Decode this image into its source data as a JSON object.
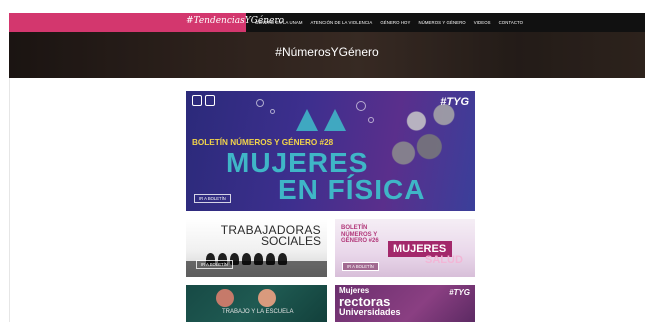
{
  "header": {
    "brand": "#TendenciasYGénero",
    "nav": [
      "GÉNERO EN LA UNAM",
      "ATENCIÓN DE LA VIOLENCIA",
      "GÉNERO HOY",
      "NÚMEROS Y GÉNERO",
      "VIDEOS",
      "CONTACTO"
    ],
    "brand_color": "#d3376e"
  },
  "hero": {
    "title": "#NúmerosYGénero"
  },
  "cards": {
    "main": {
      "tag": "#TYG",
      "subtitle": "BOLETÍN NÚMEROS Y GÉNERO #28",
      "line1": "MUJERES",
      "line2": "EN FÍSICA",
      "button": "IR A BOLETÍN"
    },
    "b1": {
      "line1": "TRABAJADORAS",
      "line2": "SOCIALES",
      "button": "IR A BOLETÍN"
    },
    "b2": {
      "topic": "BOLETÍN NÚMEROS Y GÉNERO #26",
      "line1": "MUJERES",
      "line2": "SALUD",
      "button": "IR A BOLETÍN"
    },
    "c1": {
      "text": "TRABAJO Y LA ESCUELA"
    },
    "c2": {
      "tag": "#TYG",
      "line1": "Mujeres",
      "line2": "rectoras",
      "line3": "Universidades"
    }
  }
}
